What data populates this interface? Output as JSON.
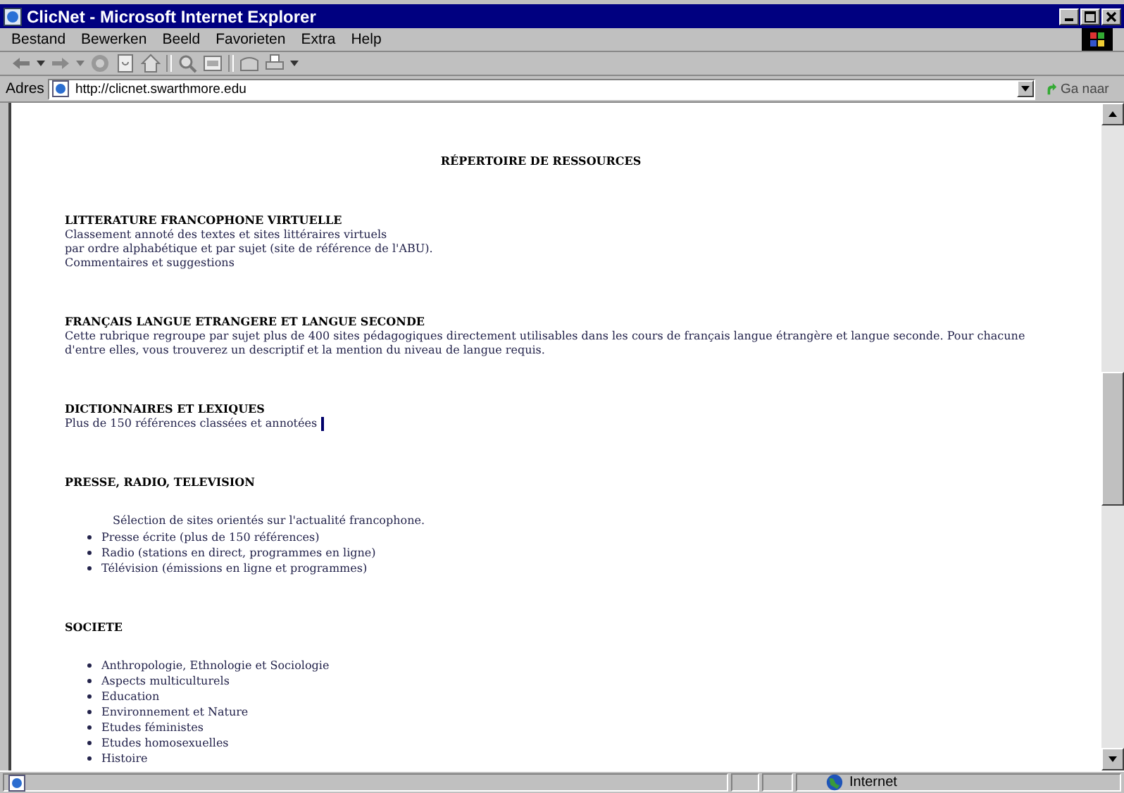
{
  "window": {
    "title": "ClicNet - Microsoft Internet Explorer"
  },
  "menu": [
    "Bestand",
    "Bewerken",
    "Beeld",
    "Favorieten",
    "Extra",
    "Help"
  ],
  "address": {
    "label": "Adres",
    "value": "http://clicnet.swarthmore.edu",
    "go": "Ga naar"
  },
  "page": {
    "title": "RÉPERTOIRE DE RESSOURCES",
    "sections": [
      {
        "heading": "LITTERATURE FRANCOPHONE VIRTUELLE",
        "lines": [
          "Classement annoté des textes et sites littéraires virtuels",
          "par ordre alphabétique et par sujet (site de référence de l'ABU).",
          "Commentaires et suggestions"
        ],
        "caret": false
      },
      {
        "heading": "FRANÇAIS LANGUE ETRANGERE ET LANGUE SECONDE",
        "lines": [
          "Cette rubrique regroupe par sujet plus de 400 sites pédagogiques directement utilisables dans les cours de français langue étrangère et langue seconde. Pour chacune",
          "d'entre elles, vous trouverez un descriptif et la mention du niveau de langue requis."
        ],
        "caret": false
      },
      {
        "heading": "DICTIONNAIRES ET LEXIQUES",
        "lines": [
          "Plus de 150 références classées et annotées"
        ],
        "caret": true
      },
      {
        "heading": "PRESSE, RADIO, TELEVISION",
        "intro": "Sélection de sites orientés sur l'actualité francophone.",
        "items": [
          "Presse écrite (plus de 150 références)",
          "Radio (stations en direct, programmes en ligne)",
          "Télévision (émissions en ligne et programmes)"
        ],
        "caret": false
      },
      {
        "heading": "SOCIETE",
        "items": [
          "Anthropologie, Ethnologie et Sociologie",
          "Aspects multiculturels",
          "Education",
          "Environnement et Nature",
          "Etudes féministes",
          "Etudes homosexuelles",
          "Histoire"
        ],
        "caret": false
      }
    ]
  },
  "status_bar": {
    "zone": "Internet"
  }
}
